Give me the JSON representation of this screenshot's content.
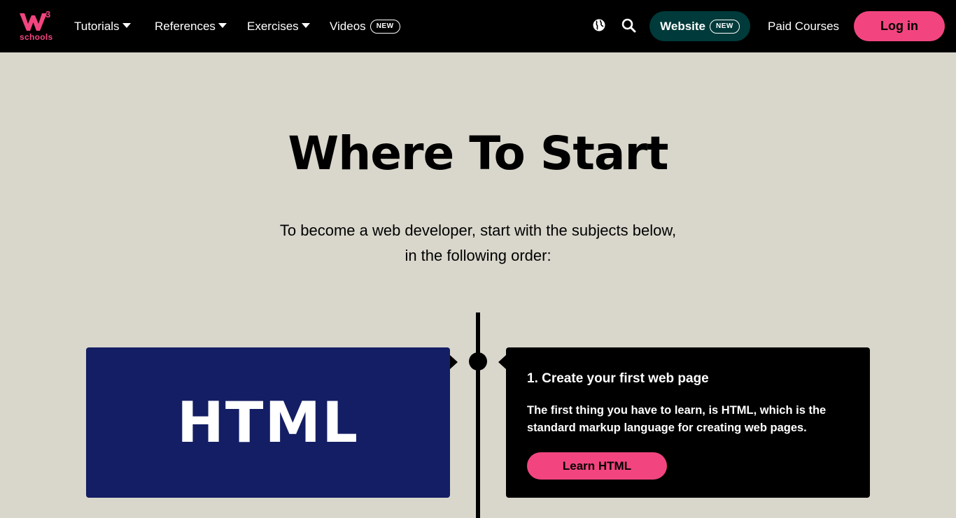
{
  "nav": {
    "logo_text": "schools",
    "logo_superscript": "3",
    "tutorials_label": "Tutorials",
    "references_label": "References",
    "exercises_label": "Exercises",
    "videos_label": "Videos",
    "videos_badge": "NEW",
    "globe_icon": "globe-icon",
    "search_icon": "search-icon",
    "website_label": "Website",
    "website_badge": "NEW",
    "paid_courses_label": "Paid Courses",
    "login_label": "Log in"
  },
  "hero": {
    "title": "Where To Start",
    "intro_line1": "To become a web developer, start with the subjects below,",
    "intro_line2": "in the following order:"
  },
  "steps": [
    {
      "card_label": "HTML",
      "title": "1. Create your first web page",
      "description": "The first thing you have to learn, is HTML, which is the standard markup language for creating web pages.",
      "button_label": "Learn HTML"
    }
  ],
  "colors": {
    "page_background": "#D9D7CC",
    "nav_background": "#000000",
    "accent_pink": "#F2457F",
    "website_button": "#003A3A",
    "html_card": "#141E64"
  }
}
